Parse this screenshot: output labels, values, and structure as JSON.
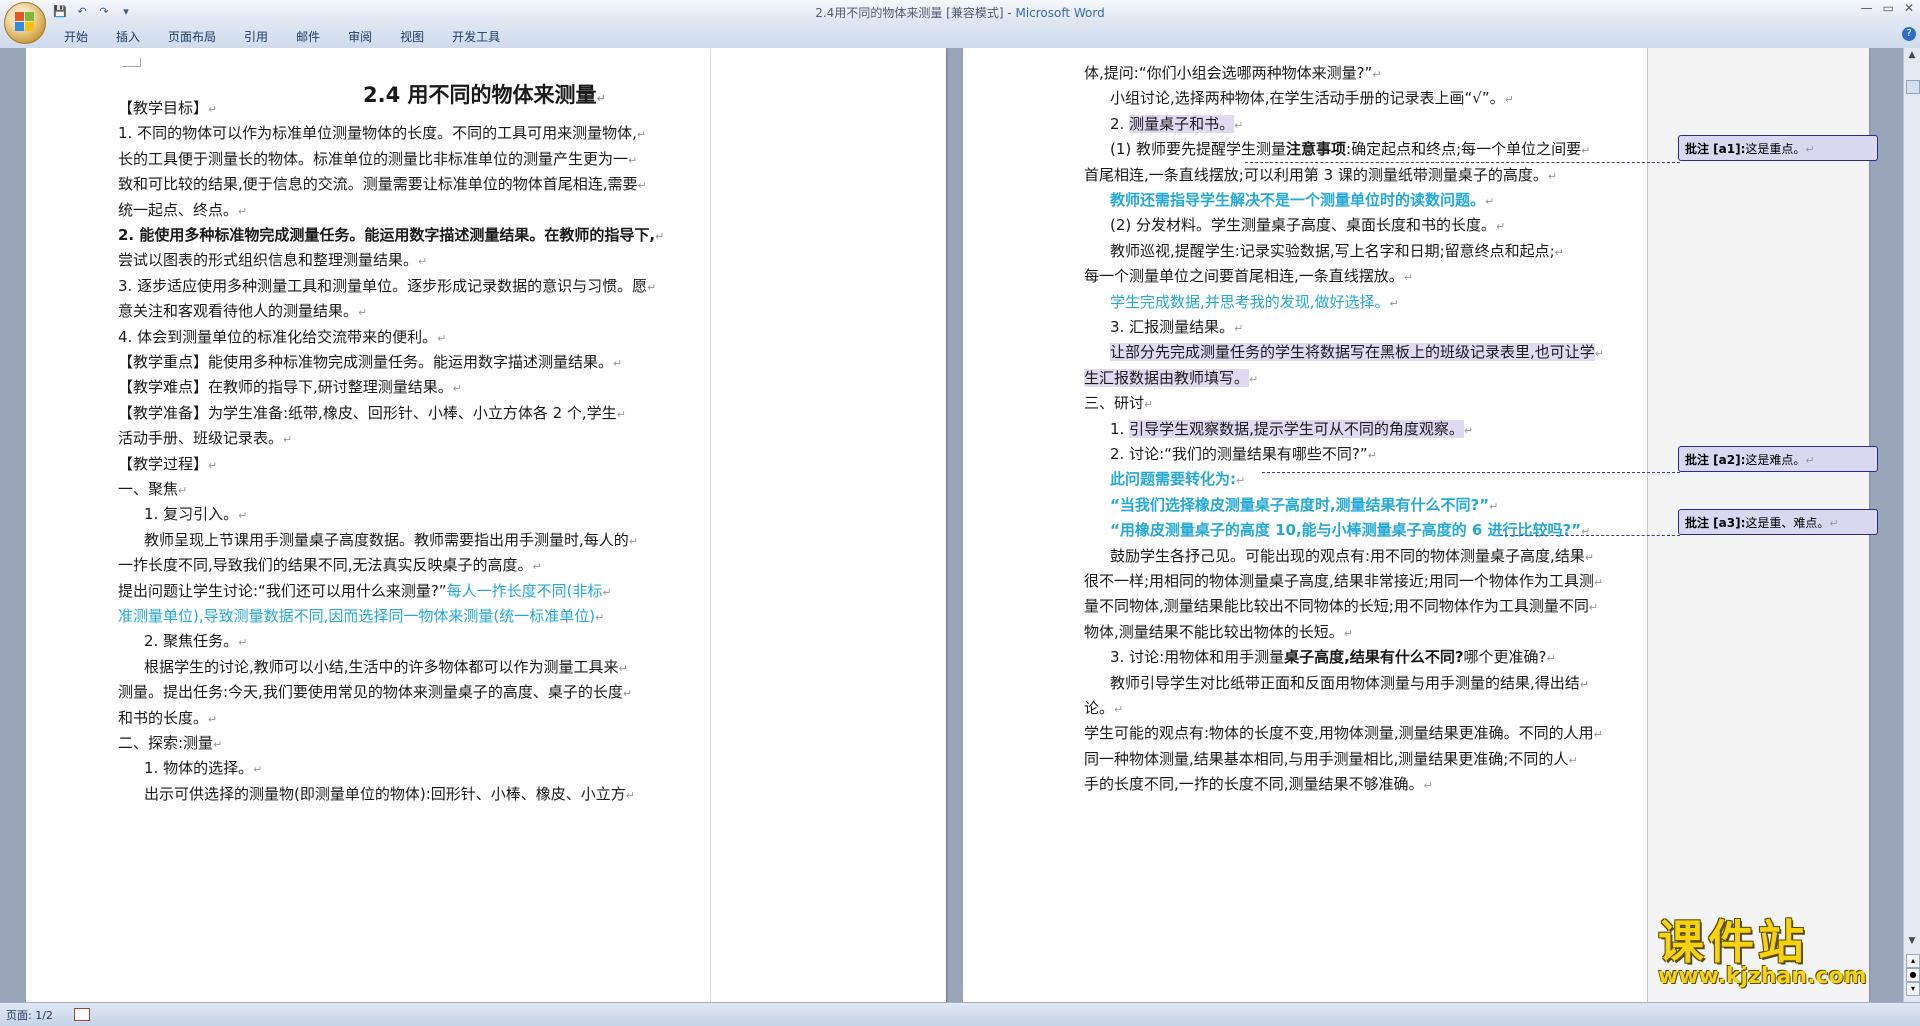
{
  "window": {
    "title": "2.4用不同的物体来测量 [兼容模式] - ",
    "app_name": "Microsoft Word"
  },
  "ribbon": {
    "tabs": [
      "开始",
      "插入",
      "页面布局",
      "引用",
      "邮件",
      "审阅",
      "视图",
      "开发工具"
    ],
    "help": "?"
  },
  "qat": {
    "save": "💾",
    "undo": "↶",
    "redo": "↷",
    "more": "▾"
  },
  "page1": {
    "title": "2.4 用不同的物体来测量",
    "lines": [
      "【教学目标】",
      "1. 不同的物体可以作为标准单位测量物体的长度。不同的工具可用来测量物体,",
      "长的工具便于测量长的物体。标准单位的测量比非标准单位的测量产生更为一",
      "致和可比较的结果,便于信息的交流。测量需要让标准单位的物体首尾相连,需要",
      "统一起点、终点。",
      "2. 能使用多种标准物完成测量任务。能运用数字描述测量结果。在教师的指导下,",
      "尝试以图表的形式组织信息和整理测量结果。",
      "3. 逐步适应使用多种测量工具和测量单位。逐步形成记录数据的意识与习惯。愿",
      "意关注和客观看待他人的测量结果。",
      "4. 体会到测量单位的标准化给交流带来的便利。",
      "【教学重点】能使用多种标准物完成测量任务。能运用数字描述测量结果。",
      "【教学难点】在教师的指导下,研讨整理测量结果。",
      "【教学准备】为学生准备:纸带,橡皮、回形针、小棒、小立方体各 2 个,学生",
      "活动手册、班级记录表。",
      "【教学过程】",
      "一、聚焦",
      "1. 复习引入。",
      "教师呈现上节课用手测量桌子高度数据。教师需要指出用手测量时,每人的",
      "一拃长度不同,导致我们的结果不同,无法真实反映桌子的高度。",
      "提出问题让学生讨论:“我们还可以用什么来测量?”",
      "每人一拃长度不同(非标",
      "准测量单位),导致测量数据不同,因而选择同一物体来测量(统一标准单位)",
      "2. 聚焦任务。",
      "根据学生的讨论,教师可以小结,生活中的许多物体都可以作为测量工具来",
      "测量。提出任务:今天,我们要使用常见的物体来测量桌子的高度、桌子的长度",
      "和书的长度。",
      "二、探索:测量",
      "1. 物体的选择。",
      "出示可供选择的测量物(即测量单位的物体):回形针、小棒、橡皮、小立方"
    ]
  },
  "page2": {
    "lines": [
      "体,提问:“你们小组会选哪两种物体来测量?”",
      "小组讨论,选择两种物体,在学生活动手册的记录表上画“√”。",
      "2. ",
      "测量桌子和书。",
      "(1) 教师要先提醒学生测量",
      "注意事项",
      ":确定起点和终点;每一个单位之间要",
      "首尾相连,一条直线摆放;可以利用第 3 课的测量纸带测量桌子的高度。",
      "教师还需指导学生解决不是一个测量单位时的读数问题。",
      "(2) 分发材料。学生测量桌子高度、桌面长度和书的长度。",
      "教师巡视,提醒学生:记录实验数据,写上名字和日期;留意终点和起点;",
      "每一个测量单位之间要首尾相连,一条直线摆放。",
      "学生完成数据,并思考我的发现,做好选择。",
      "3. 汇报测量结果。",
      "让部分先完成测量任务的学生将数据写在黑板上的班级记录表里,也可让学",
      "生汇报数据由教师填写。",
      "三、研讨",
      "1. ",
      "引导学生观察数据,提示学生可从不同的角度观察。",
      "2. 讨论:“我们的测量结果有哪些不同?”",
      "此问题需要转化为:",
      "“当我们选择橡皮测量桌子高度时,测量结果有什么不同?”",
      "“用橡皮测量桌子的高度 10,能与小棒测量桌子高度的 6 进行比较吗?”",
      "鼓励学生各抒己见。可能出现的观点有:用不同的物体测量桌子高度,结果",
      "很不一样;用相同的物体测量桌子高度,结果非常接近;用同一个物体作为工具测",
      "量不同物体,测量结果能比较出不同物体的长短;用不同物体作为工具测量不同",
      "物体,测量结果不能比较出物体的长短。",
      "3. 讨论:用物体和用手测量",
      "桌子高度,结果有什么不同?",
      "哪个更准确?",
      "教师引导学生对比纸带正面和反面用物体测量与用手测量的结果,得出结",
      "论。",
      "学生可能的观点有:物体的长度不变,用物体测量,测量结果更准确。不同的人用",
      "同一种物体测量,结果基本相同,与用手测量相比,测量结果更准确;不同的人",
      "手的长度不同,一拃的长度不同,测量结果不够准确。"
    ]
  },
  "comments": [
    {
      "label": "批注 [a1]:",
      "text": "这是重点。"
    },
    {
      "label": "批注 [a2]:",
      "text": "这是难点。"
    },
    {
      "label": "批注 [a3]:",
      "text": "这是重、难点。"
    }
  ],
  "status": {
    "page": "页面: 1/2"
  },
  "watermark": {
    "big": "课件站",
    "small": "www.kjzhan.com"
  },
  "colors": {
    "blue_text": "#25a9d8",
    "comment_fill": "#dad7f0",
    "workspace": "#99a6ba"
  }
}
